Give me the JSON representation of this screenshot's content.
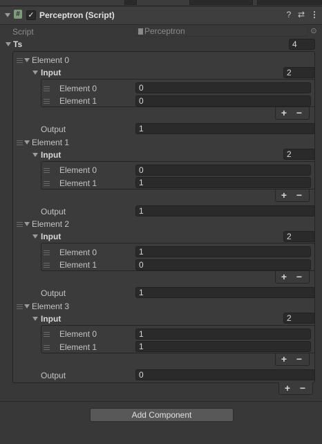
{
  "component": {
    "title": "Perceptron (Script)",
    "enabled": true,
    "icons": [
      "help-icon",
      "preset-icon",
      "menu-icon"
    ]
  },
  "script": {
    "label": "Script",
    "value": "Perceptron"
  },
  "ts": {
    "label": "Ts",
    "size": "4",
    "elements": [
      {
        "label": "Element 0",
        "input_label": "Input",
        "input_size": "2",
        "inputs": [
          {
            "label": "Element 0",
            "value": "0"
          },
          {
            "label": "Element 1",
            "value": "0"
          }
        ],
        "output_label": "Output",
        "output": "1"
      },
      {
        "label": "Element 1",
        "input_label": "Input",
        "input_size": "2",
        "inputs": [
          {
            "label": "Element 0",
            "value": "0"
          },
          {
            "label": "Element 1",
            "value": "1"
          }
        ],
        "output_label": "Output",
        "output": "1"
      },
      {
        "label": "Element 2",
        "input_label": "Input",
        "input_size": "2",
        "inputs": [
          {
            "label": "Element 0",
            "value": "1"
          },
          {
            "label": "Element 1",
            "value": "0"
          }
        ],
        "output_label": "Output",
        "output": "1"
      },
      {
        "label": "Element 3",
        "input_label": "Input",
        "input_size": "2",
        "inputs": [
          {
            "label": "Element 0",
            "value": "1"
          },
          {
            "label": "Element 1",
            "value": "1"
          }
        ],
        "output_label": "Output",
        "output": "0"
      }
    ]
  },
  "list_controls": {
    "add": "+",
    "remove": "−"
  },
  "add_component_label": "Add Component"
}
